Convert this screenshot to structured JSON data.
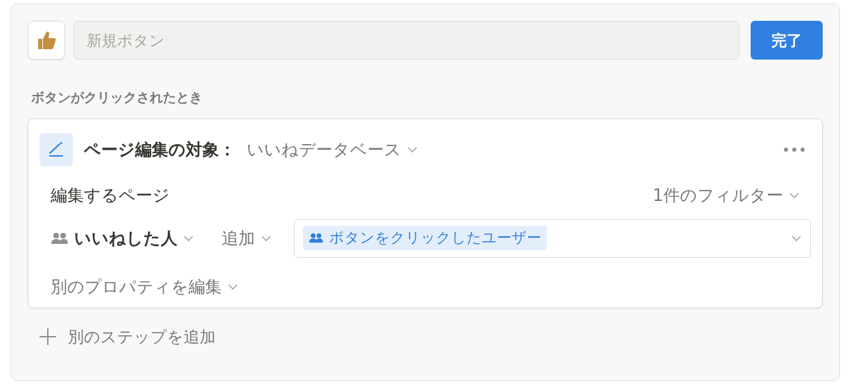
{
  "name_field": {
    "placeholder": "新規ボタン"
  },
  "done_button": "完了",
  "trigger_label": "ボタンがクリックされたとき",
  "step": {
    "title": "ページ編集の対象：",
    "database": "いいねデータベース",
    "pages_label": "編集するページ",
    "filter": "1件のフィルター",
    "property": {
      "name": "いいねした人",
      "operation": "追加",
      "value_chip": "ボタンをクリックしたユーザー"
    },
    "edit_another": "別のプロパティを編集"
  },
  "add_step": "別のステップを追加"
}
